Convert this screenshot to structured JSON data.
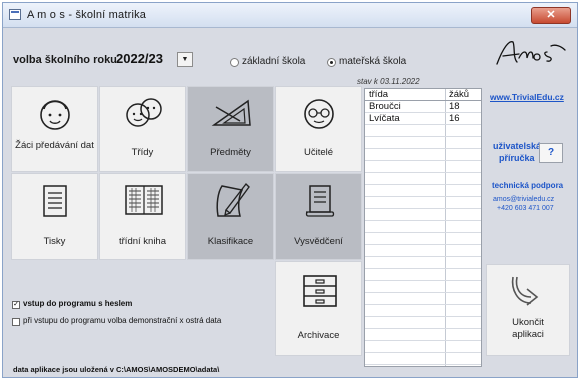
{
  "window": {
    "title": "A m o s - školní matrika",
    "close_glyph": "✕"
  },
  "header": {
    "year_label": "volba školního roku",
    "year_value": "2022/23",
    "dropdown_glyph": "▼",
    "school_options": [
      {
        "label": "základní škola",
        "selected": false
      },
      {
        "label": "mateřská škola",
        "selected": true
      }
    ],
    "stav": "stav k 03.11.2022"
  },
  "tiles": {
    "zaci": "Žáci předávání dat",
    "tridy": "Třídy",
    "predmety": "Předměty",
    "ucitele": "Učitelé",
    "tisky": "Tisky",
    "tridni_kniha": "třídní kniha",
    "klasifikace": "Klasifikace",
    "vysvedceni": "Vysvědčení",
    "archivace": "Archivace",
    "ukoncit": "Ukončit aplikaci"
  },
  "table": {
    "columns": [
      "třída",
      "žáků"
    ],
    "rows": [
      {
        "trida": "Broučci",
        "zaku": "18"
      },
      {
        "trida": "Lvíčata",
        "zaku": "16"
      }
    ]
  },
  "right_panel": {
    "website": "www.TrivialEdu.cz",
    "manual_line1": "uživatelská",
    "manual_line2": "příručka",
    "help_label": "?",
    "support_title": "technická podpora",
    "support_email": "amos@trivialedu.cz",
    "support_phone": "+420 603 471 007"
  },
  "options": {
    "password": {
      "label": "vstup do programu s heslem",
      "checked": true,
      "check_glyph": "✓"
    },
    "demo": {
      "label": "při vstupu do programu volba demonstrační x ostrá data",
      "checked": false
    }
  },
  "footer": {
    "path": "data aplikace jsou uložená v C:\\AMOS\\AMOSDEMO\\adata\\"
  },
  "colors": {
    "link": "#1d55c8",
    "close": "#c74a31",
    "background": "#d8dbe3"
  }
}
